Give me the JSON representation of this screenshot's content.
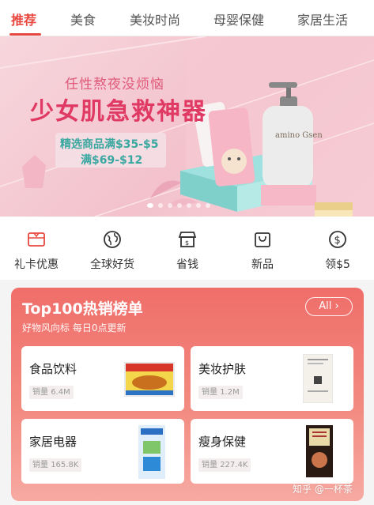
{
  "tabs": [
    {
      "label": "推荐",
      "active": true
    },
    {
      "label": "美食",
      "active": false
    },
    {
      "label": "美妆时尚",
      "active": false
    },
    {
      "label": "母婴保健",
      "active": false
    },
    {
      "label": "家居生活",
      "active": false
    }
  ],
  "banner": {
    "subtitle": "任性熬夜没烦恼",
    "title": "少女肌急救神器",
    "promo_line1": "精选商品满$35-$5",
    "promo_line2": "满$69-$12",
    "product_label": "amino Gsen",
    "slide_count": 7,
    "active_slide": 1
  },
  "quick_links": [
    {
      "label": "礼卡优惠",
      "icon": "gift-card-icon"
    },
    {
      "label": "全球好货",
      "icon": "globe-icon"
    },
    {
      "label": "省钱",
      "icon": "store-icon"
    },
    {
      "label": "新品",
      "icon": "new-bag-icon"
    },
    {
      "label": "领$5",
      "icon": "dollar-coin-icon"
    }
  ],
  "top100": {
    "title": "Top100热销榜单",
    "subtitle": "好物风向标 每日0点更新",
    "all_label": "All ›",
    "sales_prefix": "销量",
    "categories": [
      {
        "name": "食品饮料",
        "sales": "6.4M"
      },
      {
        "name": "美妆护肤",
        "sales": "1.2M"
      },
      {
        "name": "家居电器",
        "sales": "165.8K"
      },
      {
        "name": "瘦身保健",
        "sales": "227.4K"
      }
    ]
  },
  "watermark": "知乎 @一杯茶",
  "colors": {
    "accent": "#e8473f",
    "banner_title": "#e03a64",
    "promo_text": "#3aa7a0",
    "panel_top": "#f06e6a"
  }
}
